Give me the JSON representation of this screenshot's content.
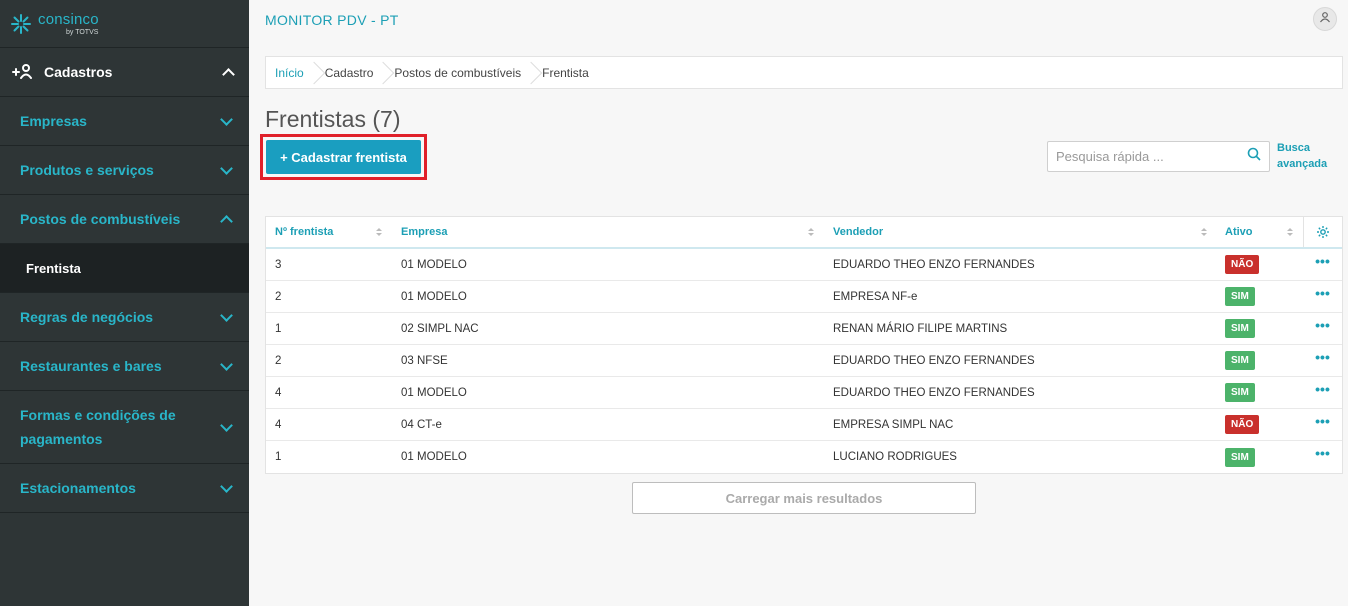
{
  "logo": {
    "name": "consinco",
    "by": "by TOTVS"
  },
  "sidebar": {
    "section": {
      "label": "Cadastros",
      "icon": "add-user-icon"
    },
    "items": [
      {
        "label": "Empresas"
      },
      {
        "label": "Produtos e serviços"
      },
      {
        "label": "Postos de combustíveis",
        "expanded": true
      },
      {
        "label": "Regras de negócios"
      },
      {
        "label": "Restaurantes e bares"
      },
      {
        "label": "Formas e condições de pagamentos"
      },
      {
        "label": "Estacionamentos"
      }
    ],
    "sub_active": "Frentista"
  },
  "header": {
    "title": "MONITOR PDV - PT",
    "user_icon": "user-icon"
  },
  "breadcrumb": [
    "Início",
    "Cadastro",
    "Postos de combustíveis",
    "Frentista"
  ],
  "page": {
    "title": "Frentistas (7)",
    "add_button": "+ Cadastrar frentista",
    "search_placeholder": "Pesquisa rápida ...",
    "advanced_search": "Busca avançada",
    "load_more": "Carregar mais resultados"
  },
  "table": {
    "columns": [
      "Nº frentista",
      "Empresa",
      "Vendedor",
      "Ativo"
    ],
    "rows": [
      {
        "num": "3",
        "empresa": "01 MODELO",
        "vendedor": "EDUARDO THEO ENZO FERNANDES",
        "ativo": "NÃO"
      },
      {
        "num": "2",
        "empresa": "01 MODELO",
        "vendedor": "EMPRESA NF-e",
        "ativo": "SIM"
      },
      {
        "num": "1",
        "empresa": "02 SIMPL NAC",
        "vendedor": "RENAN MÁRIO FILIPE MARTINS",
        "ativo": "SIM"
      },
      {
        "num": "2",
        "empresa": "03 NFSE",
        "vendedor": "EDUARDO THEO ENZO FERNANDES",
        "ativo": "SIM"
      },
      {
        "num": "4",
        "empresa": "01 MODELO",
        "vendedor": "EDUARDO THEO ENZO FERNANDES",
        "ativo": "SIM"
      },
      {
        "num": "4",
        "empresa": "04 CT-e",
        "vendedor": "EMPRESA SIMPL NAC",
        "ativo": "NÃO"
      },
      {
        "num": "1",
        "empresa": "01 MODELO",
        "vendedor": "LUCIANO RODRIGUES",
        "ativo": "SIM"
      }
    ],
    "row_action": "•••"
  },
  "colors": {
    "accent": "#1c9fb5",
    "sidebar_bg": "#2e3536",
    "sim": "#4cb36a",
    "nao": "#c9302c",
    "highlight": "#e0202a"
  }
}
